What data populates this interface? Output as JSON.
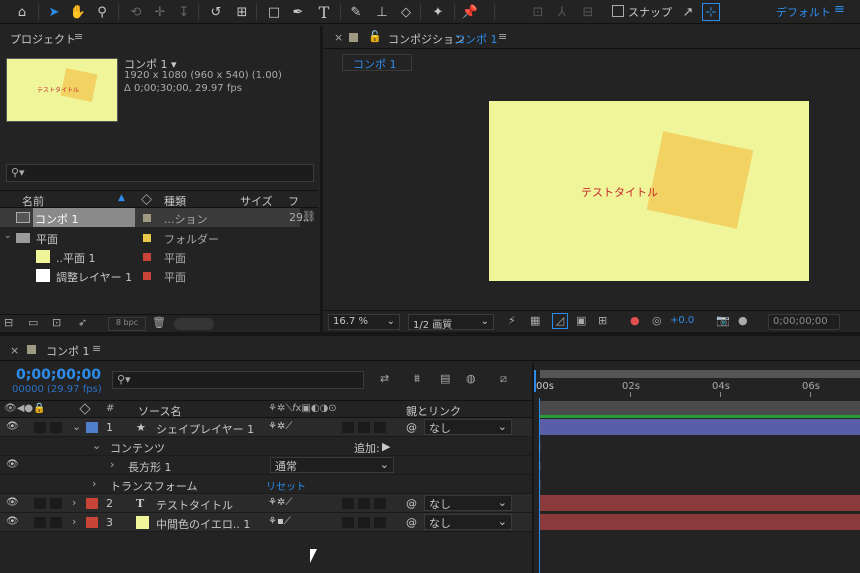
{
  "toolbar": {
    "snap_label": "スナップ",
    "workspace_label": "デフォルト"
  },
  "project": {
    "title": "プロジェクト",
    "comp_name": "コンポ 1 ▾",
    "comp_info1": "1920 x 1080  (960 x 540) (1.00)",
    "comp_info2": "Δ 0;00;30;00, 29.97 fps",
    "thumb_text": "テストタイトル",
    "search_placeholder": "",
    "columns": [
      "名前",
      "種類",
      "サイズ",
      "フレ..."
    ],
    "items": [
      {
        "name": "コンポ 1",
        "type": "...ション",
        "size": "29",
        "color": "#9e9a84"
      },
      {
        "name": "平面",
        "type": "フォルダー",
        "size": "",
        "color": "#e8c84a"
      },
      {
        "name": "..平面 1",
        "type": "平面",
        "size": "",
        "color": "#c84438"
      },
      {
        "name": "調整レイヤー 1",
        "type": "平面",
        "size": "",
        "color": "#c84438"
      }
    ],
    "bpc": "8 bpc"
  },
  "composition": {
    "tab_label": "コンポジション",
    "tab_comp": "コンポ 1",
    "breadcrumb": "コンポ 1",
    "title_text": "テストタイトル",
    "zoom": "16.7 %",
    "resolution": "1/2 画質",
    "exposure": "+0.0",
    "timecode": "0;00;00;00"
  },
  "timeline": {
    "tab": "コンポ 1",
    "timecode": "0;00;00;00",
    "frames": "00000 (29.97 fps)",
    "col_source": "ソース名",
    "col_parent": "親とリンク",
    "ruler": [
      "00s",
      "02s",
      "04s",
      "06s"
    ],
    "add_label": "追加:",
    "reset_label": "リセット",
    "layers": [
      {
        "num": "1",
        "name": "シェイプレイヤー 1",
        "parent": "なし",
        "color": "#4f7ecf"
      },
      {
        "name": "コンテンツ"
      },
      {
        "name": "長方形 1",
        "mode": "通常"
      },
      {
        "name": "トランスフォーム"
      },
      {
        "num": "2",
        "name": "テストタイトル",
        "parent": "なし",
        "color": "#c84438"
      },
      {
        "num": "3",
        "name": "中間色のイエロ.. 1",
        "parent": "なし",
        "color": "#c84438"
      }
    ]
  },
  "colors": {
    "accent": "#2d8ceb",
    "comp_bg": "#f0f59a",
    "square": "#f2d262",
    "title_red": "#c82828",
    "bar_blue": "#5a5ea8",
    "bar_red": "#8a3a3a"
  }
}
